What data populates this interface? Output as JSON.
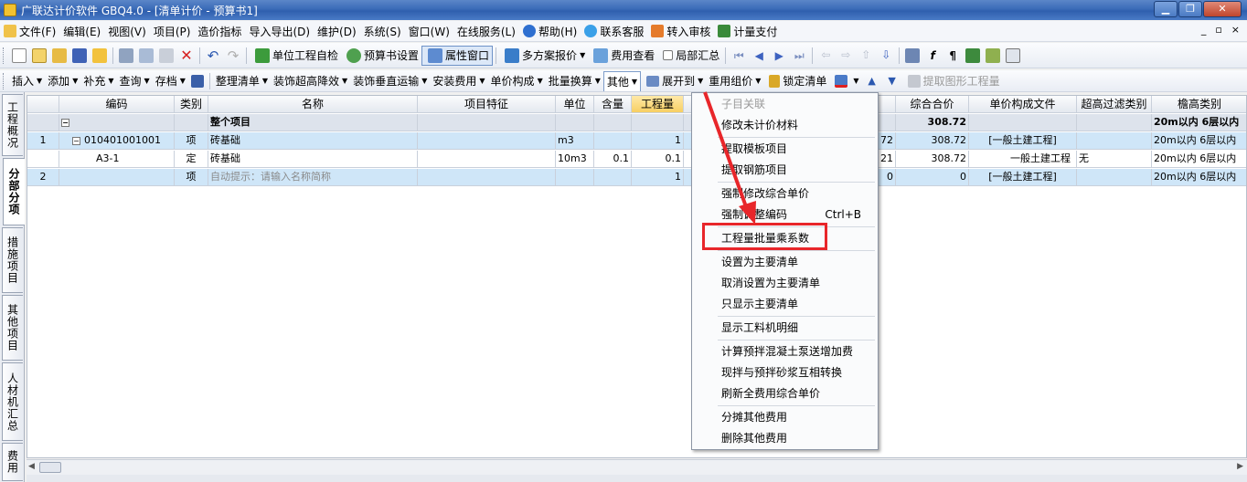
{
  "window": {
    "title": "广联达计价软件 GBQ4.0 - [清单计价 - 预算书1]",
    "controls": {
      "minimize": "▁",
      "restore": "❐",
      "close": "✕"
    }
  },
  "menubar": {
    "items": [
      "文件(F)",
      "编辑(E)",
      "视图(V)",
      "项目(P)",
      "造价指标",
      "导入导出(D)",
      "维护(D)",
      "系统(S)",
      "窗口(W)",
      "在线服务(L)",
      "帮助(H)",
      "联系客服",
      "转入审核",
      "计量支付"
    ],
    "mdi": [
      "_",
      "▫",
      "×"
    ]
  },
  "toolbar1": {
    "self_check": "单位工程自检",
    "budget_settings": "预算书设置",
    "property_window": "属性窗口",
    "multi_plan_quote": "多方案报价",
    "fee_view": "费用查看",
    "local_summary": "局部汇总"
  },
  "toolbar2": {
    "items": [
      "插入",
      "添加",
      "补充",
      "查询",
      "存档"
    ],
    "items2": [
      "整理清单",
      "装饰超高降效",
      "装饰垂直运输",
      "安装费用",
      "单价构成",
      "批量换算",
      "其他",
      "展开到",
      "重用组价",
      "锁定清单"
    ],
    "extract_graphic": "提取图形工程量"
  },
  "sidetabs": [
    "工程概况",
    "分部分项",
    "措施项目",
    "其他项目",
    "人材机汇总",
    "费用"
  ],
  "grid": {
    "headers": {
      "code": "编码",
      "type": "类别",
      "name": "名称",
      "feature": "项目特征",
      "unit": "单位",
      "content": "含量",
      "qty": "工程量",
      "total": "综合合价",
      "unit_file": "单价构成文件",
      "filter": "超高过滤类别",
      "eave": "檐高类别"
    },
    "rows": [
      {
        "no": "",
        "code": "",
        "type": "",
        "name": "整个项目",
        "unit": "",
        "content": "",
        "qty": "",
        "hidden": "",
        "total": "308.72",
        "unit_file": "",
        "filter": "",
        "eave": "20m以内 6层以内"
      },
      {
        "no": "1",
        "code": "010401001001",
        "type": "项",
        "name": "砖基础",
        "unit": "m3",
        "content": "",
        "qty": "1",
        "hidden": "72",
        "total": "308.72",
        "unit_file": "[一般土建工程]",
        "filter": "",
        "eave": "20m以内 6层以内"
      },
      {
        "no": "",
        "code": "A3-1",
        "type": "定",
        "name": "砖基础",
        "unit": "10m3",
        "content": "0.1",
        "qty": "0.1",
        "hidden": "21",
        "total": "308.72",
        "unit_file": "一般土建工程",
        "filter": "无",
        "eave": "20m以内 6层以内"
      },
      {
        "no": "2",
        "code": "",
        "type": "项",
        "name": "自动提示：请输入名称简称",
        "unit": "",
        "content": "",
        "qty": "1",
        "hidden": "0",
        "total": "0",
        "unit_file": "[一般土建工程]",
        "filter": "",
        "eave": "20m以内 6层以内"
      }
    ]
  },
  "context_menu": {
    "items": [
      {
        "label": "子目关联",
        "shortcut": "",
        "disabled": true
      },
      {
        "label": "修改未计价材料",
        "shortcut": ""
      },
      {
        "label": "提取模板项目",
        "shortcut": ""
      },
      {
        "label": "提取钢筋项目",
        "shortcut": ""
      },
      {
        "label": "强制修改综合单价",
        "shortcut": ""
      },
      {
        "label": "强制调整编码",
        "shortcut": "Ctrl+B"
      },
      {
        "label": "工程量批量乘系数",
        "shortcut": "",
        "highlighted": true
      },
      {
        "label": "设置为主要清单",
        "shortcut": ""
      },
      {
        "label": "取消设置为主要清单",
        "shortcut": ""
      },
      {
        "label": "只显示主要清单",
        "shortcut": ""
      },
      {
        "label": "显示工料机明细",
        "shortcut": ""
      },
      {
        "label": "计算预拌混凝土泵送增加费",
        "shortcut": ""
      },
      {
        "label": "现拌与预拌砂浆互相转换",
        "shortcut": ""
      },
      {
        "label": "刷新全费用综合单价",
        "shortcut": ""
      },
      {
        "label": "分摊其他费用",
        "shortcut": ""
      },
      {
        "label": "删除其他费用",
        "shortcut": ""
      }
    ]
  },
  "colors": {
    "title_bar": "#3a6bb8",
    "selected_row": "#cfe6f8",
    "highlight_box": "#e8262a",
    "arrow": "#e8262a",
    "qty_header": "#f7cf62"
  },
  "icons": [
    "file-icon",
    "edit-icon",
    "view-icon",
    "help-icon",
    "service-icon",
    "audit-icon",
    "payment-icon",
    "new-icon",
    "open-icon",
    "save-icon",
    "cut-icon",
    "copy-icon",
    "paste-icon",
    "delete-icon",
    "undo-icon",
    "redo-icon",
    "check-icon",
    "settings-icon",
    "lock-icon",
    "paint-icon",
    "arrow-up-icon",
    "arrow-down-icon",
    "first-icon",
    "prev-icon",
    "next-icon",
    "last-icon"
  ]
}
